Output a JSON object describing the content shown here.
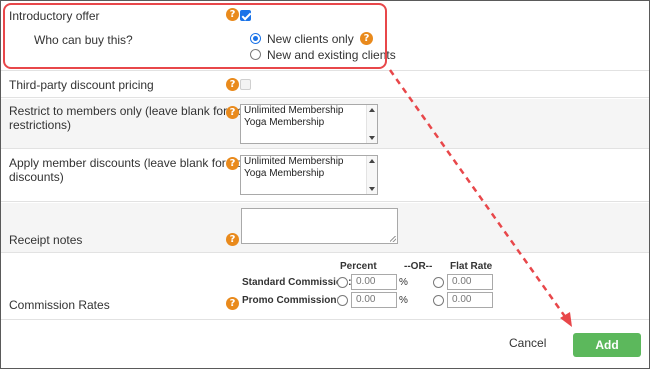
{
  "intro_offer": {
    "label": "Introductory offer",
    "checked": true,
    "sub_label": "Who can buy this?",
    "options": [
      {
        "label": "New clients only",
        "selected": true
      },
      {
        "label": "New and existing clients",
        "selected": false
      }
    ]
  },
  "third_party": {
    "label": "Third-party discount pricing",
    "checked": false,
    "disabled": true
  },
  "restrict_members": {
    "label_line1": "Restrict to members only (leave blank for no",
    "label_line2": "restrictions)",
    "options": [
      "Unlimited Membership",
      "Yoga Membership"
    ]
  },
  "member_discounts": {
    "label_line1": "Apply member discounts (leave blank for no",
    "label_line2": "discounts)",
    "options": [
      "Unlimited Membership",
      "Yoga Membership"
    ]
  },
  "receipt_notes": {
    "label": "Receipt notes",
    "value": ""
  },
  "commission": {
    "label": "Commission Rates",
    "header_percent": "Percent",
    "header_or": "--OR--",
    "header_flat": "Flat Rate",
    "percent_sign": "%",
    "rows": [
      {
        "label": "Standard Commission:",
        "percent": "0.00",
        "flat": "0.00"
      },
      {
        "label": "Promo Commission:",
        "percent": "0.00",
        "flat": "0.00"
      }
    ]
  },
  "help_glyph": "?",
  "help_icon_name": "help-icon",
  "footer": {
    "cancel_label": "Cancel",
    "add_label": "Add"
  },
  "colors": {
    "accent_blue": "#1a73e8",
    "help_orange": "#e98a1c",
    "annotation_red": "#e8474a",
    "add_green": "#5cb85c"
  }
}
